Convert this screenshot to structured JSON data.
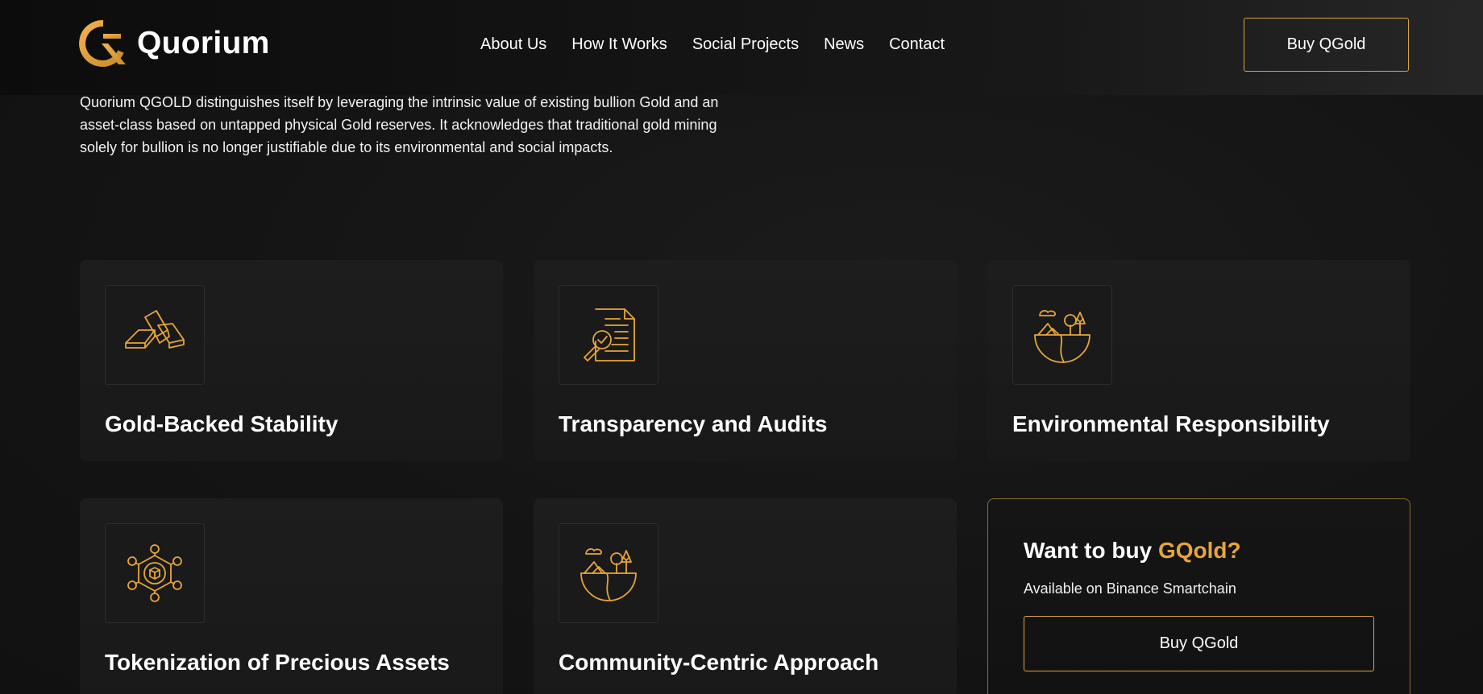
{
  "brand": {
    "name": "Quorium",
    "logo_icon": "quorium-q-logo-icon",
    "accent_color": "#E6A53C"
  },
  "nav": {
    "items": [
      {
        "label": "About Us"
      },
      {
        "label": "How It Works"
      },
      {
        "label": "Social Projects"
      },
      {
        "label": "News"
      },
      {
        "label": "Contact"
      }
    ],
    "cta_label": "Buy QGold"
  },
  "intro": {
    "text": "Quorium QGOLD distinguishes itself by leveraging the intrinsic value of existing bullion Gold and an asset-class based on untapped physical Gold reserves. It acknowledges that traditional gold mining solely for bullion is no longer justifiable due to its environmental and social impacts."
  },
  "features": [
    {
      "title": "Gold-Backed Stability",
      "icon": "gold-bars-icon"
    },
    {
      "title": "Transparency and Audits",
      "icon": "document-audit-icon"
    },
    {
      "title": "Environmental Responsibility",
      "icon": "earth-nature-icon"
    },
    {
      "title": "Tokenization of Precious Assets",
      "icon": "blockchain-cube-icon"
    },
    {
      "title": "Community-Centric Approach",
      "icon": "earth-nature-icon"
    }
  ],
  "cta": {
    "title_prefix": "Want to buy ",
    "title_accent": "GQold?",
    "subtitle": "Available on Binance Smartchain",
    "button_label": "Buy QGold"
  }
}
